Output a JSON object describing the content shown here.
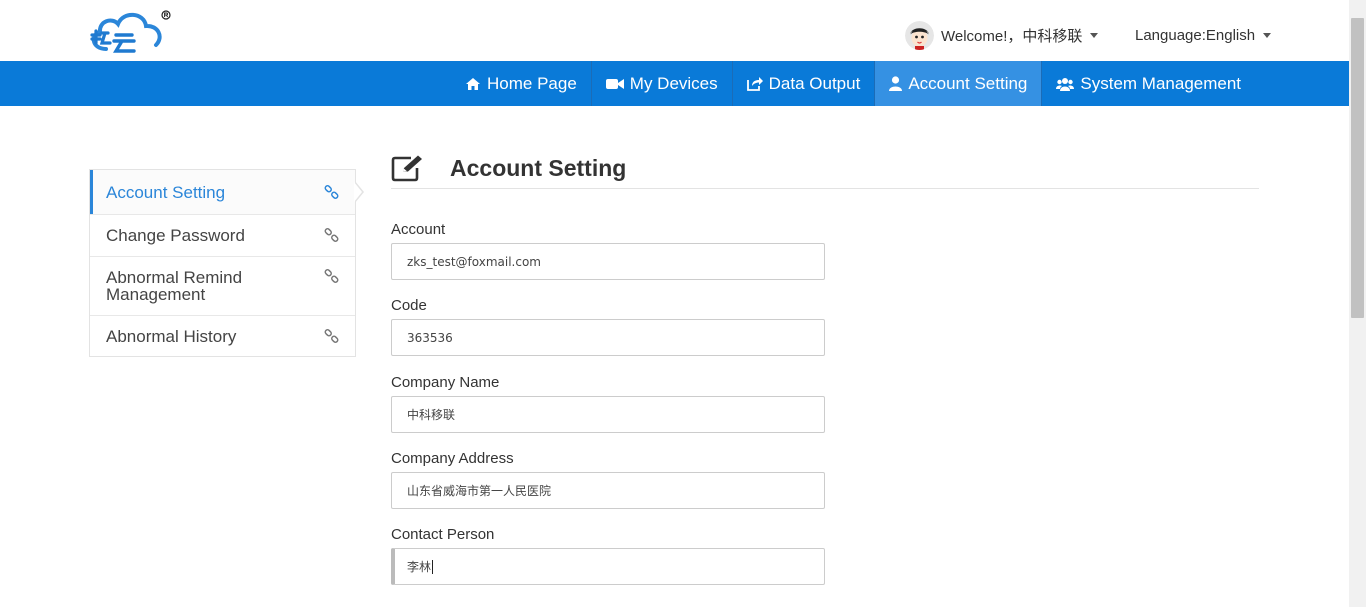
{
  "header": {
    "user_greeting": "Welcome!，中科移联",
    "language": "Language:English"
  },
  "nav": {
    "items": [
      {
        "label": "Home Page",
        "icon": "home-icon"
      },
      {
        "label": "My Devices",
        "icon": "video-camera-icon"
      },
      {
        "label": "Data Output",
        "icon": "share-icon"
      },
      {
        "label": "Account Setting",
        "icon": "user-icon",
        "active": true
      },
      {
        "label": "System Management",
        "icon": "users-icon"
      }
    ]
  },
  "sidebar": {
    "items": [
      {
        "label": "Account Setting",
        "active": true
      },
      {
        "label": "Change Password"
      },
      {
        "label": "Abnormal Remind Management"
      },
      {
        "label": "Abnormal History"
      }
    ]
  },
  "main": {
    "title": "Account Setting",
    "fields": [
      {
        "label": "Account",
        "value": "zks_test@foxmail.com"
      },
      {
        "label": "Code",
        "value": "363536"
      },
      {
        "label": "Company Name",
        "value": "中科移联"
      },
      {
        "label": "Company Address",
        "value": "山东省威海市第一人民医院"
      },
      {
        "label": "Contact Person",
        "value": "李林"
      }
    ]
  },
  "colors": {
    "nav_bg": "#0a7ad8",
    "nav_active": "#3591e3",
    "accent": "#2b86d9"
  }
}
